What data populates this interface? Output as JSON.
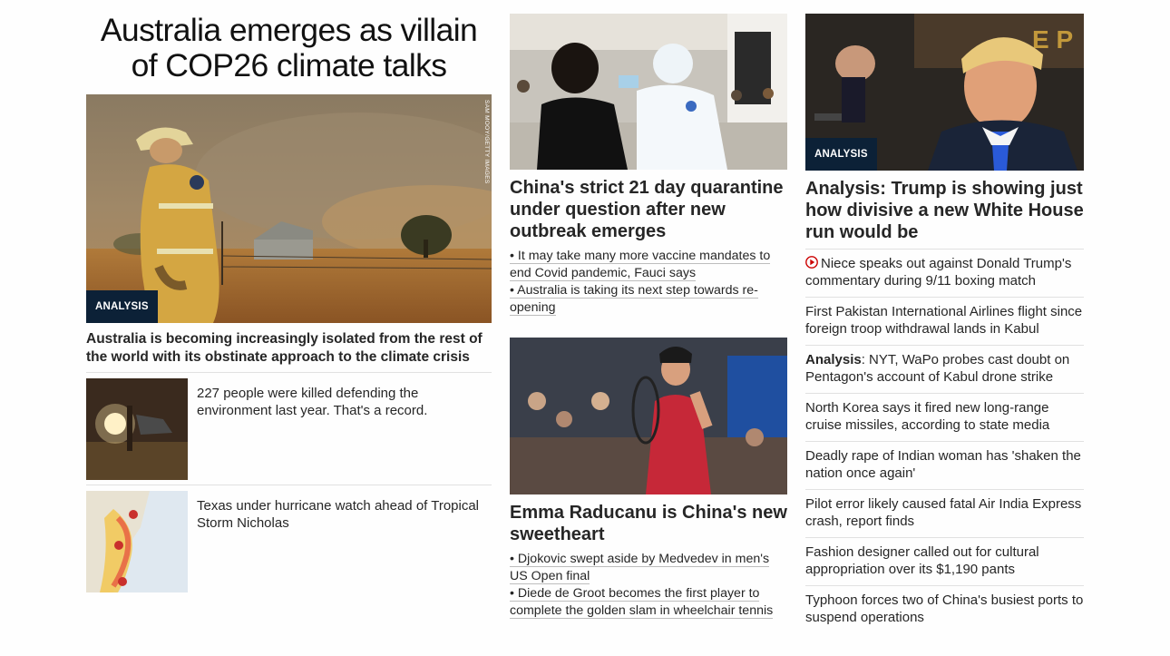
{
  "left": {
    "headline": "Australia emerges as villain of COP26 climate talks",
    "hero_badge": "ANALYSIS",
    "hero_credit": "SAM MOOY/GETTY IMAGES",
    "hero_caption": "Australia is becoming increasingly isolated from the rest of the world with its obstinate approach to the climate crisis",
    "cards": [
      {
        "text": "227 people were killed defending the environment last year. That's a record."
      },
      {
        "text": "Texas under hurricane watch ahead of Tropical Storm Nicholas"
      }
    ]
  },
  "mid": {
    "stories": [
      {
        "headline": "China's strict 21 day quarantine under question after new outbreak emerges",
        "bullets": [
          "• It may take many more vaccine mandates to end Covid pandemic, Fauci says",
          "• Australia is taking its next step towards re-opening"
        ]
      },
      {
        "headline": "Emma Raducanu is China's new sweetheart",
        "bullets": [
          "• Djokovic swept aside by Medvedev in men's US Open final",
          "• Diede de Groot becomes the first player to complete the golden slam in wheelchair tennis"
        ]
      }
    ]
  },
  "right": {
    "badge": "ANALYSIS",
    "headline": "Analysis: Trump is showing just how divisive a new White House run would be",
    "items": [
      {
        "prefix": "",
        "text": "Niece speaks out against Donald Trump's commentary during 9/11 boxing match",
        "icon": "play-circle-icon"
      },
      {
        "prefix": "",
        "text": "First Pakistan International Airlines flight since foreign troop withdrawal lands in Kabul"
      },
      {
        "prefix": "Analysis",
        "text": ": NYT, WaPo probes cast doubt on Pentagon's account of Kabul drone strike"
      },
      {
        "prefix": "",
        "text": "North Korea says it fired new long-range cruise missiles, according to state media"
      },
      {
        "prefix": "",
        "text": "Deadly rape of Indian woman has 'shaken the nation once again'"
      },
      {
        "prefix": "",
        "text": "Pilot error likely caused fatal Air India Express crash, report finds"
      },
      {
        "prefix": "",
        "text": "Fashion designer called out for cultural appropriation over its $1,190 pants"
      },
      {
        "prefix": "",
        "text": "Typhoon forces two of China's busiest ports to suspend operations"
      }
    ]
  },
  "colors": {
    "badge_bg": "#0c2137",
    "play_red": "#cc0000",
    "divider": "#e1e1e1"
  }
}
